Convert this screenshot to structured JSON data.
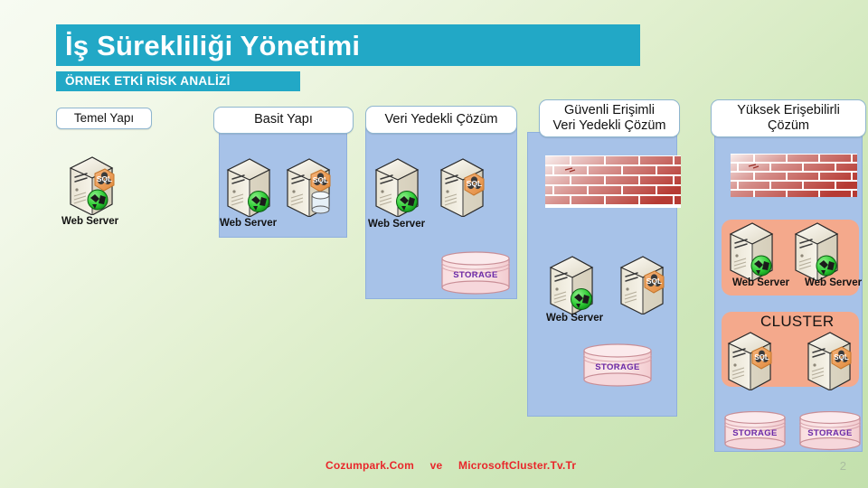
{
  "title": "İş Sürekliliği Yönetimi",
  "subtitle": "ÖRNEK ETKİ RİSK ANALİZİ",
  "colors": {
    "title_band": "#22a8c6",
    "panel_blue": "#a7c2e8",
    "group_salmon": "#f4a98c",
    "storage_pink": "#f7d7da",
    "footer_red": "#e8272b",
    "background_green": "#c3e0ad"
  },
  "columns": [
    {
      "id": "temel-yapi",
      "header": "Temel Yapı",
      "has_panel": false,
      "nodes": [
        {
          "type": "server-sql-web",
          "label": "Web Server"
        }
      ]
    },
    {
      "id": "basit-yapi",
      "header": "Basit Yapı",
      "has_panel": true,
      "nodes": [
        {
          "type": "server-web",
          "label": "Web Server"
        },
        {
          "type": "server-sql-db",
          "label": ""
        }
      ]
    },
    {
      "id": "veri-yedekli-cozum",
      "header": "Veri Yedekli Çözüm",
      "has_panel": true,
      "nodes": [
        {
          "type": "server-web",
          "label": "Web Server"
        },
        {
          "type": "server-sql",
          "label": ""
        },
        {
          "type": "storage",
          "label": "STORAGE"
        }
      ]
    },
    {
      "id": "guvenli-erisimli-veri-yedekli-cozum",
      "header": "Güvenli Erişimli\nVeri Yedekli Çözüm",
      "header_line1": "Güvenli Erişimli",
      "header_line2": "Veri Yedekli Çözüm",
      "has_panel": true,
      "nodes": [
        {
          "type": "firewall",
          "label": ""
        },
        {
          "type": "server-web",
          "label": "Web Server"
        },
        {
          "type": "server-sql",
          "label": ""
        },
        {
          "type": "storage",
          "label": "STORAGE"
        }
      ]
    },
    {
      "id": "yuksek-erisebilirli-cozum",
      "header_line1": "Yüksek Erişebilirli",
      "header_line2": "Çözüm",
      "has_panel": true,
      "group_label": "CLUSTER",
      "nodes": [
        {
          "type": "firewall",
          "label": ""
        },
        {
          "type": "server-web",
          "label": "Web Server"
        },
        {
          "type": "server-web",
          "label": "Web Server"
        },
        {
          "type": "server-sql",
          "label": ""
        },
        {
          "type": "server-sql",
          "label": ""
        },
        {
          "type": "storage",
          "label": "STORAGE"
        },
        {
          "type": "storage",
          "label": "STORAGE"
        }
      ]
    }
  ],
  "footer": {
    "text": "Cozumpark.Com     ve     MicrosoftCluster.Tv.Tr",
    "page_number": "2"
  }
}
